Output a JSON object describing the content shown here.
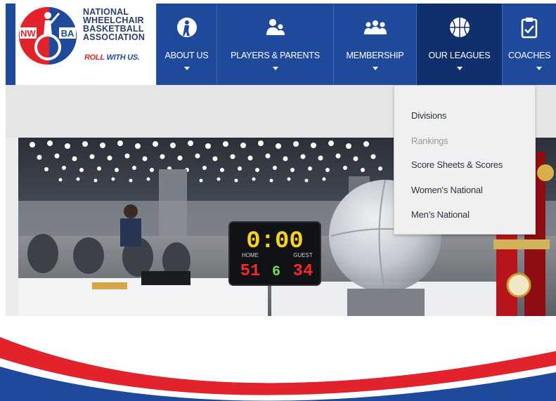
{
  "logo": {
    "badge_left": "NW",
    "badge_right": "BA",
    "name_lines": [
      "NATIONAL",
      "WHEELCHAIR",
      "BASKETBALL",
      "ASSOCIATION"
    ],
    "tagline_roll": "ROLL",
    "tagline_rest": " WITH US."
  },
  "nav": {
    "items": [
      {
        "label": "ABOUT US",
        "icon": "basketball-player-icon"
      },
      {
        "label": "PLAYERS & PARENTS",
        "icon": "parent-child-icon"
      },
      {
        "label": "MEMBERSHIP",
        "icon": "group-icon"
      },
      {
        "label": "OUR LEAGUES",
        "icon": "basketball-icon",
        "active": true
      },
      {
        "label": "COACHES",
        "icon": "clipboard-icon"
      }
    ]
  },
  "dropdown": {
    "items": [
      {
        "label": "Divisions"
      },
      {
        "label": "Rankings",
        "muted": true
      },
      {
        "label": "Score Sheets & Scores"
      },
      {
        "label": "Women's National"
      },
      {
        "label": "Men's National"
      }
    ]
  },
  "scoreboard": {
    "clock": "0:00",
    "home_label": "HOME",
    "guest_label": "GUEST",
    "home_score": "51",
    "period": "6",
    "guest_score": "34"
  },
  "colors": {
    "nav_blue": "#1f4a9c",
    "nav_active": "#0f2f6d",
    "brand_red": "#e3232c"
  }
}
